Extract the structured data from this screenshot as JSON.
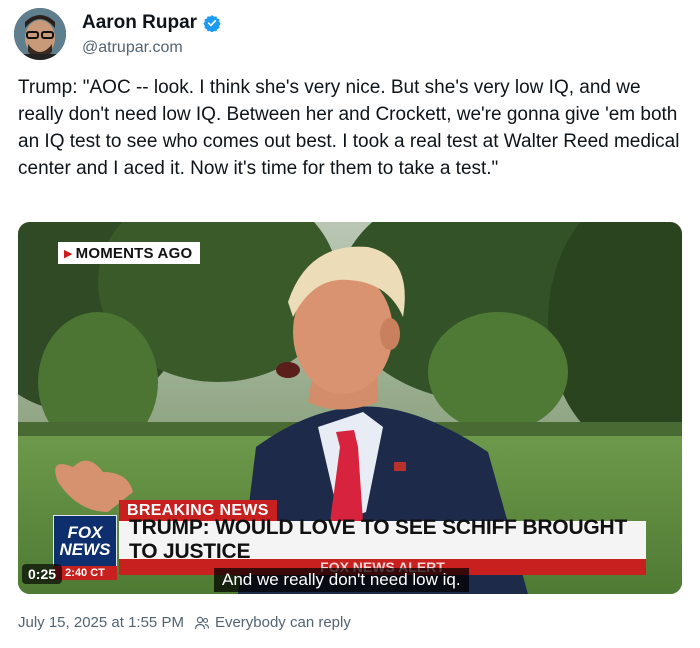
{
  "author": {
    "name": "Aaron Rupar",
    "handle": "@atrupar.com"
  },
  "post": {
    "text": "Trump: \"AOC -- look. I think she's very nice. But she's very low IQ, and we really don't need low IQ. Between her and Crockett, we're gonna give 'em both an IQ test to see who comes out best. I took a real test at Walter Reed medical center and I aced it. Now it's time for them to take a test.\""
  },
  "video": {
    "moments_label": "MOMENTS AGO",
    "breaking_label": "BREAKING NEWS",
    "headline": "TRUMP: WOULD LOVE TO SEE SCHIFF BROUGHT TO JUSTICE",
    "logo_line1": "FOX",
    "logo_line2": "NEWS",
    "alert_text": "FOX NEWS ALERT",
    "channel_time": "2:40 CT",
    "caption": "And we really don't need low iq.",
    "duration": "0:25"
  },
  "footer": {
    "timestamp": "July 15, 2025 at 1:55 PM",
    "reply_setting": "Everybody can reply"
  },
  "colors": {
    "verified": "#1d9bf0",
    "breaking_red": "#c8201f",
    "fox_blue": "#0d2f6e"
  },
  "icons": {
    "verified": "verified-badge-icon",
    "reply": "people-icon",
    "play": "play-triangle-icon"
  }
}
